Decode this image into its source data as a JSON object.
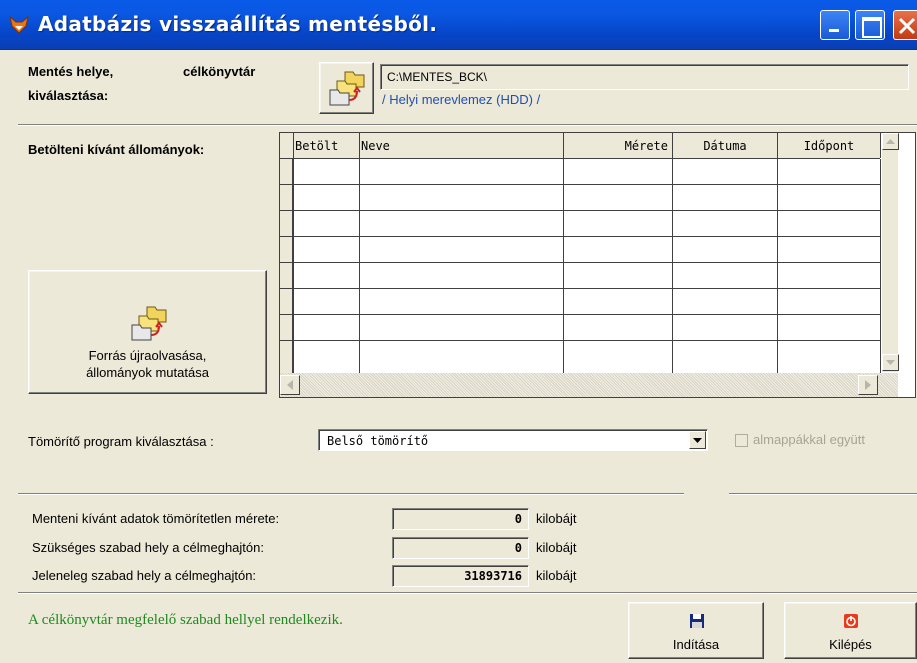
{
  "window": {
    "title": "Adatbázis visszaállítás mentésből.",
    "colors": {
      "titlebar": "#0a5ae8",
      "face": "#ece9d8",
      "status_text": "#1f8a1f",
      "link_text": "#1f4fb3"
    }
  },
  "target": {
    "label_line1_left": "Mentés helye,",
    "label_line1_right": "célkönyvtár",
    "label_line2": "kiválasztása:",
    "path": "C:\\MENTES_BCK\\",
    "drive": "/ Helyi merevlemez (HDD) /",
    "button_icon": "folder-sync-icon"
  },
  "files": {
    "label": "Betölteni kívánt állományok:",
    "columns": [
      "Betölt",
      "Neve",
      "Mérete",
      "Dátuma",
      "Időpont"
    ],
    "rows": [],
    "reload_button": {
      "line1": "Forrás újraolvasása,",
      "line2": "állományok mutatása"
    }
  },
  "compressor": {
    "label": "Tömörítő program kiválasztása :",
    "selected": "Belső tömörítő",
    "checkbox_label": "almappákkal együtt",
    "checkbox_checked": false
  },
  "sizes": {
    "unit": "kilobájt",
    "items": [
      {
        "label": "Menteni kívánt adatok tömörítetlen mérete:",
        "value": "0"
      },
      {
        "label": "Szükséges szabad hely a célmeghajtón:",
        "value": "0"
      },
      {
        "label": "Jeleneleg szabad hely a célmeghajtón:",
        "value": "31893716"
      }
    ]
  },
  "status": "A célkönyvtár megfelelő szabad hellyel rendelkezik.",
  "buttons": {
    "start": "Indítása",
    "exit": "Kilépés"
  }
}
